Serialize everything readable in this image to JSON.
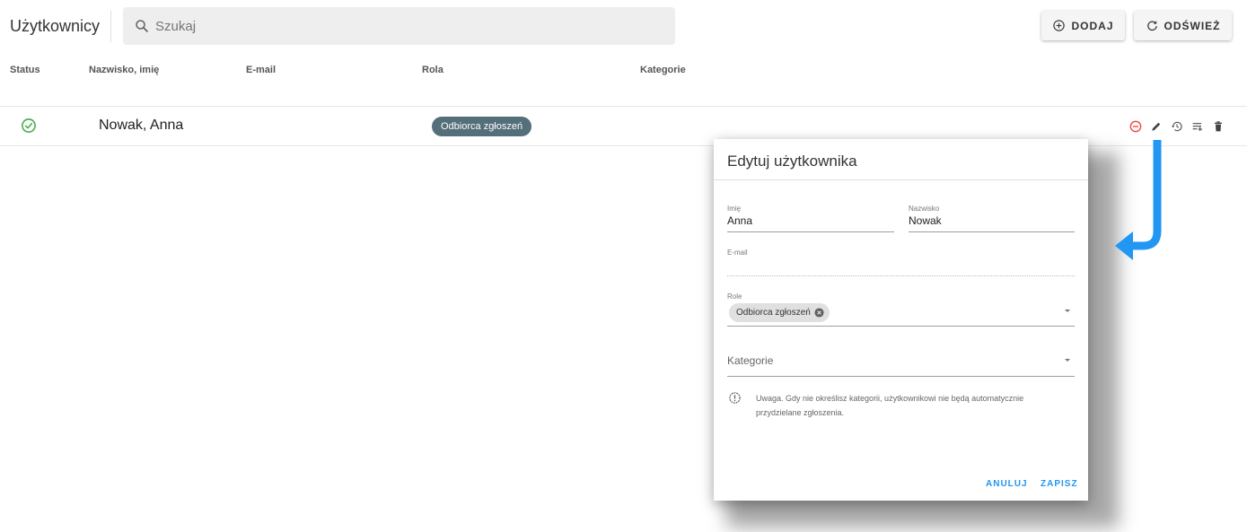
{
  "header": {
    "title": "Użytkownicy",
    "search_placeholder": "Szukaj",
    "add_label": "DODAJ",
    "refresh_label": "ODŚWIEŻ"
  },
  "table": {
    "columns": [
      "Status",
      "Nazwisko, imię",
      "E-mail",
      "Rola",
      "Kategorie"
    ],
    "rows": [
      {
        "status": "active",
        "name": "Nowak, Anna",
        "email": "",
        "role": "Odbiorca zgłoszeń",
        "categories": ""
      }
    ]
  },
  "row_actions": [
    "deactivate-icon",
    "edit-icon",
    "history-icon",
    "assign-list-icon",
    "delete-icon"
  ],
  "dialog": {
    "title": "Edytuj użytkownika",
    "first_name_label": "Imię",
    "first_name_value": "Anna",
    "last_name_label": "Nazwisko",
    "last_name_value": "Nowak",
    "email_label": "E-mail",
    "email_value": "",
    "roles_label": "Role",
    "roles_selected": [
      "Odbiorca zgłoszeń"
    ],
    "categories_placeholder": "Kategorie",
    "info_text": "Uwaga. Gdy nie określisz kategorii, użytkownikowi nie będą automatycznie przydzielane zgłoszenia.",
    "cancel_label": "ANULUJ",
    "save_label": "ZAPISZ"
  },
  "colors": {
    "accent": "#2196f3",
    "status_active": "#4caf50",
    "deactivate": "#f44336",
    "role_chip": "#546e7a"
  }
}
